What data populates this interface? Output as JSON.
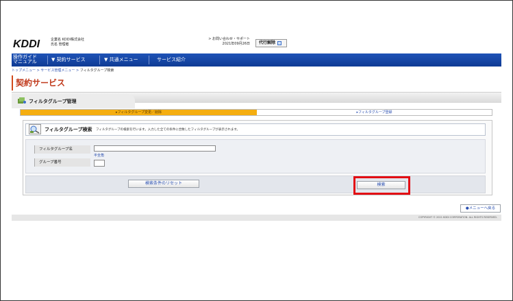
{
  "header": {
    "logo": "KDDI",
    "company_label": "企業名",
    "company_name": "KDDI株式会社",
    "user_label": "氏名",
    "user_name": "管理者",
    "contact": "> お問い合わせ・サポート",
    "date": "2021年09月26日",
    "agent_button": "代行解除"
  },
  "nav": {
    "guide_line1": "操作ガイド",
    "guide_line2": "マニュアル",
    "items": [
      "▼ 契約サービス",
      "▼ 共通メニュー",
      "サービス紹介"
    ]
  },
  "breadcrumb": {
    "link1": "トップメニュー",
    "link2": "サービス管理メニュー",
    "current": "フィルタグループ検索",
    "sep": " > "
  },
  "page_title": "契約サービス",
  "section_title": "フィルタグループ管理",
  "tabs": {
    "active": "▸フィルタグループ変更／削除",
    "inactive": "▸フィルタグループ登録"
  },
  "search_panel": {
    "title": "フィルタグループ検索",
    "description": "フィルタグループの検索を行います。入力した全ての条件に合致したフィルタグループが表示されます。"
  },
  "form": {
    "name_label": "フィルタグループ名",
    "name_value": "",
    "name_hint": "半全角",
    "number_label": "グループ番号",
    "number_value": ""
  },
  "buttons": {
    "reset": "検索条件のリセット",
    "search": "検索",
    "back": "●メニューへ戻る"
  },
  "footer": "COPYRIGHT © 2021 KDDI CORPORATION. ALL RIGHTS RESERVED.",
  "colors": {
    "nav_blue": "#1e53b7",
    "title_red": "#c0391b",
    "tab_orange": "#f5ae10",
    "highlight_red": "#e30b13"
  }
}
